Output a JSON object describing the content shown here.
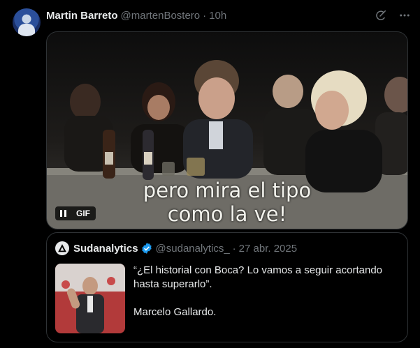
{
  "tweet": {
    "author_name": "Martin Barreto",
    "author_handle": "@martenBostero",
    "separator": "·",
    "time": "10h",
    "icons": [
      "grok-icon",
      "more-icon"
    ]
  },
  "media": {
    "caption_line1": "pero mira el tipo",
    "caption_line2": "como la ve!",
    "badge": "GIF"
  },
  "quote": {
    "author_name": "Sudanalytics",
    "author_handle": "@sudanalytics_",
    "separator": "·",
    "date": "27 abr. 2025",
    "text_line1": "“¿El historial con Boca? Lo vamos a seguir acortando hasta superarlo”.",
    "text_line2": "Marcelo Gallardo."
  },
  "colors": {
    "background": "#000000",
    "text": "#e7e9ea",
    "muted": "#71767b",
    "border": "#2f3336",
    "verified": "#1d9bf0"
  }
}
